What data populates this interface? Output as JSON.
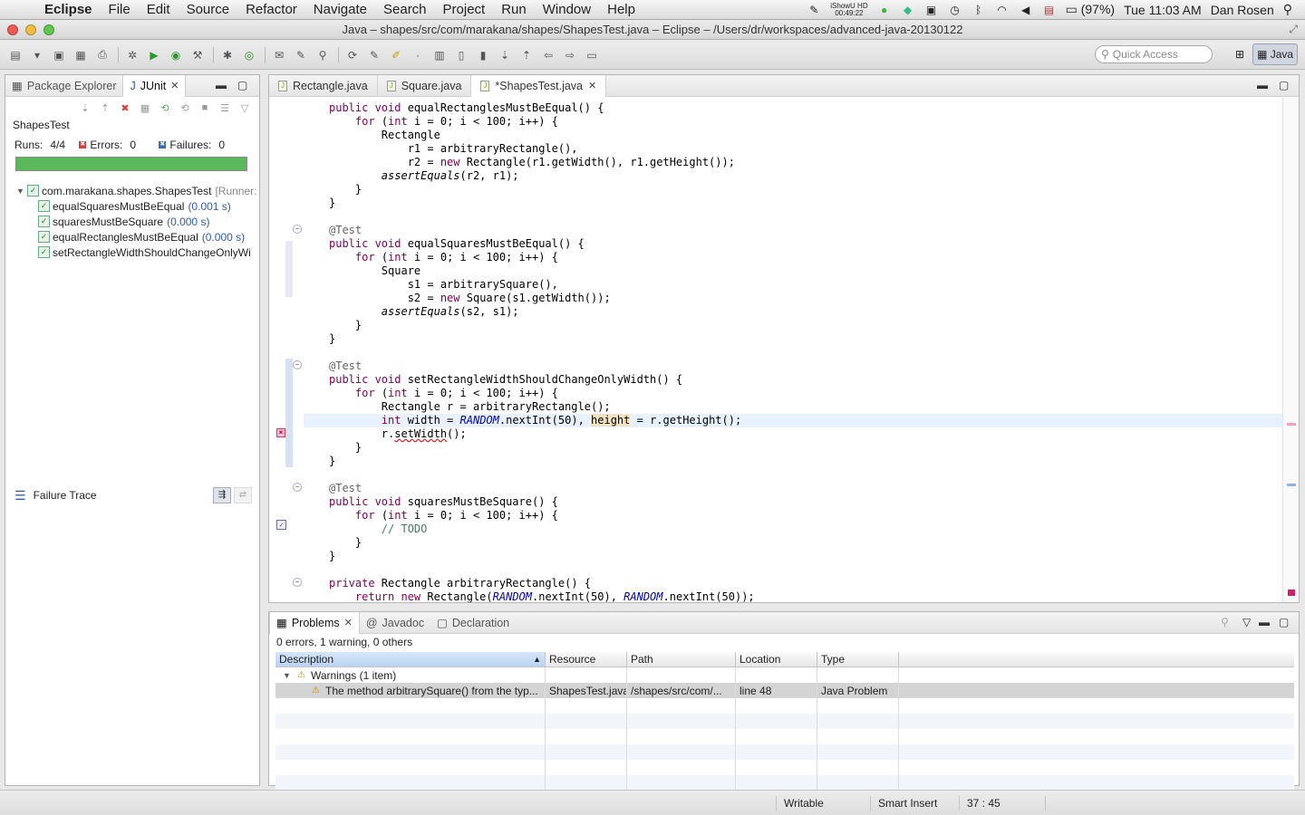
{
  "menubar": {
    "app": "Eclipse",
    "items": [
      "File",
      "Edit",
      "Source",
      "Refactor",
      "Navigate",
      "Search",
      "Project",
      "Run",
      "Window",
      "Help"
    ],
    "ishow_line1": "iShowU HD",
    "ishow_line2": "00:49:22",
    "battery": "(97%)",
    "clock": "Tue 11:03 AM",
    "user": "Dan Rosen"
  },
  "window": {
    "title": "Java – shapes/src/com/marakana/shapes/ShapesTest.java – Eclipse – /Users/dr/workspaces/advanced-java-20130122"
  },
  "toolbar": {
    "quick_access_placeholder": "Quick Access",
    "perspective": "Java"
  },
  "left_view": {
    "tabs": [
      {
        "label": "Package Explorer",
        "active": false
      },
      {
        "label": "JUnit",
        "active": true
      }
    ],
    "suite": "ShapesTest",
    "runs_label": "Runs:",
    "runs_value": "4/4",
    "errors_label": "Errors:",
    "errors_value": "0",
    "failures_label": "Failures:",
    "failures_value": "0",
    "progress": 1.0,
    "tree": {
      "root_label": "com.marakana.shapes.ShapesTest",
      "root_runner": "[Runner:",
      "tests": [
        {
          "name": "equalSquaresMustBeEqual",
          "time": "(0.001 s)"
        },
        {
          "name": "squaresMustBeSquare",
          "time": "(0.000 s)"
        },
        {
          "name": "equalRectanglesMustBeEqual",
          "time": "(0.000 s)"
        },
        {
          "name": "setRectangleWidthShouldChangeOnlyWi",
          "time": ""
        }
      ]
    },
    "failure_trace_label": "Failure Trace"
  },
  "editor": {
    "tabs": [
      {
        "label": "Rectangle.java",
        "active": false
      },
      {
        "label": "Square.java",
        "active": false
      },
      {
        "label": "*ShapesTest.java",
        "active": true
      }
    ]
  },
  "problems": {
    "tabs": [
      {
        "label": "Problems",
        "active": true
      },
      {
        "label": "Javadoc",
        "active": false
      },
      {
        "label": "Declaration",
        "active": false
      }
    ],
    "summary": "0 errors, 1 warning, 0 others",
    "columns": [
      "Description",
      "Resource",
      "Path",
      "Location",
      "Type"
    ],
    "group_label": "Warnings (1 item)",
    "rows": [
      {
        "description": "The method arbitrarySquare() from the typ...",
        "resource": "ShapesTest.java",
        "path": "/shapes/src/com/...",
        "location": "line 48",
        "type": "Java Problem"
      }
    ]
  },
  "status": {
    "writable": "Writable",
    "insert_mode": "Smart Insert",
    "position": "37 : 45"
  },
  "colors": {
    "progress_green": "#5bb85b",
    "keyword": "#7f0055",
    "current_line": "#e8f2fe"
  }
}
